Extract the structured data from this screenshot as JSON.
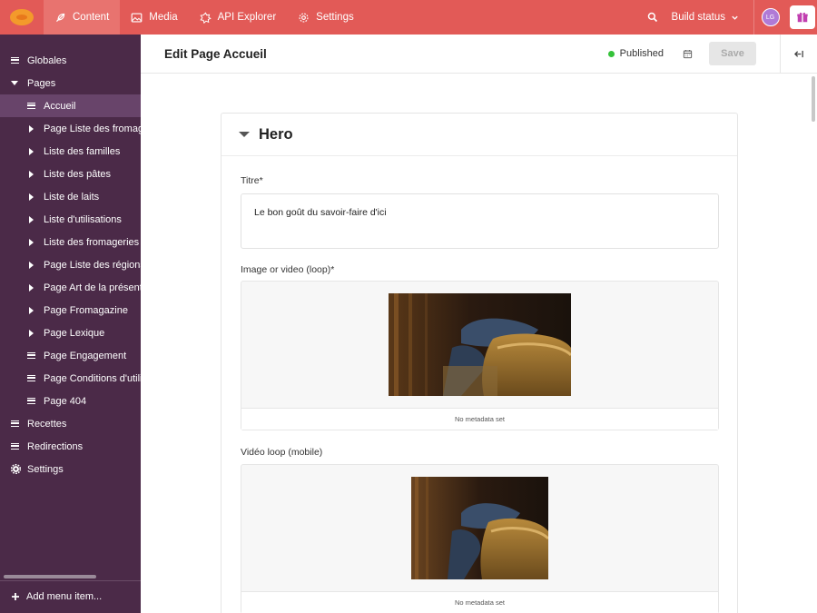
{
  "topbar": {
    "nav": [
      {
        "label": "Content",
        "icon": "feather-icon"
      },
      {
        "label": "Media",
        "icon": "image-icon"
      },
      {
        "label": "API Explorer",
        "icon": "plugin-icon"
      },
      {
        "label": "Settings",
        "icon": "gear-icon"
      }
    ],
    "build_status": "Build status",
    "avatar_initials": "LG"
  },
  "sidebar": {
    "items": [
      {
        "label": "Globales"
      },
      {
        "label": "Pages"
      },
      {
        "label": "Accueil"
      },
      {
        "label": "Page Liste des fromag"
      },
      {
        "label": "Liste des familles"
      },
      {
        "label": "Liste des pâtes"
      },
      {
        "label": "Liste de laits"
      },
      {
        "label": "Liste d'utilisations"
      },
      {
        "label": "Liste des fromageries"
      },
      {
        "label": "Page Liste des régions"
      },
      {
        "label": "Page Art de la présenta"
      },
      {
        "label": "Page Fromagazine"
      },
      {
        "label": "Page Lexique"
      },
      {
        "label": "Page Engagement"
      },
      {
        "label": "Page Conditions d'utili"
      },
      {
        "label": "Page 404"
      },
      {
        "label": "Recettes"
      },
      {
        "label": "Redirections"
      },
      {
        "label": "Settings"
      }
    ],
    "add_menu_item": "Add menu item..."
  },
  "header": {
    "title": "Edit Page Accueil",
    "status": "Published",
    "save_label": "Save"
  },
  "card": {
    "title": "Hero",
    "fields": {
      "titre_label": "Titre*",
      "titre_value": "Le bon goût du savoir-faire d'ici",
      "video_label": "Image or video (loop)*",
      "video_meta": "No metadata set",
      "mobile_label": "Vidéo loop (mobile)",
      "mobile_meta": "No metadata set"
    }
  },
  "colors": {
    "topbar": "#e25a57",
    "sidebar": "#4b2a48",
    "published_dot": "#35c23a"
  }
}
